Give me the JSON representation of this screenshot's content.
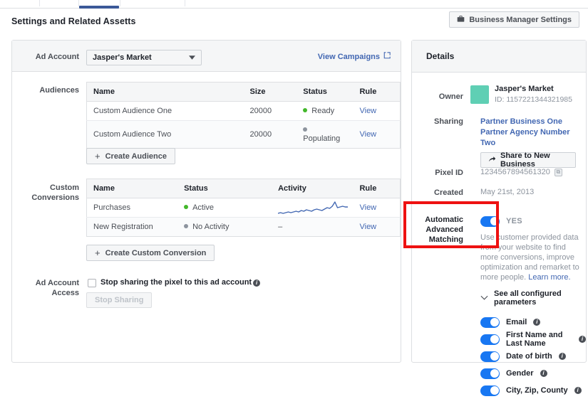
{
  "tabs": {
    "active_index": 2,
    "count": 5
  },
  "header": {
    "title": "Settings and Related Assetts",
    "bm_settings_button": "Business Manager Settings",
    "bm_settings_icon": "briefcase-icon"
  },
  "ad_account": {
    "label": "Ad Account",
    "selected": "Jasper's Market",
    "chevron_icon": "chevron-down-icon",
    "view_campaigns": "View Campaigns",
    "external_link_icon": "external-link-icon"
  },
  "audiences": {
    "label": "Audiences",
    "columns": [
      "Name",
      "Size",
      "Status",
      "Rule"
    ],
    "rows": [
      {
        "name": "Custom Audience One",
        "size": "20000",
        "status": "Ready",
        "status_dot": "green",
        "rule": "View"
      },
      {
        "name": "Custom Audience Two",
        "size": "20000",
        "status": "Populating",
        "status_dot": "gray",
        "rule": "View"
      }
    ],
    "create_button": "Create Audience"
  },
  "custom_conversions": {
    "label_line1": "Custom",
    "label_line2": "Conversions",
    "columns": [
      "Name",
      "Status",
      "Activity",
      "Rule"
    ],
    "rows": [
      {
        "name": "Purchases",
        "status": "Active",
        "status_dot": "green",
        "activity": "sparkline",
        "rule": "View"
      },
      {
        "name": "New Registration",
        "status": "No Activity",
        "status_dot": "gray",
        "activity": "–",
        "rule": "View"
      }
    ],
    "create_button": "Create Custom Conversion",
    "sparkline_color": "#4267b2",
    "sparkline_values": [
      14,
      15,
      14,
      15,
      16,
      15,
      16,
      17,
      16,
      18,
      17,
      19,
      18,
      17,
      19,
      20,
      19,
      18,
      20,
      22,
      21,
      24,
      30,
      22,
      23,
      24,
      23,
      23
    ]
  },
  "ad_account_access": {
    "label_line1": "Ad Account",
    "label_line2": "Access",
    "checkbox_label": "Stop sharing the pixel to this ad account",
    "info_icon": "info-icon",
    "button": "Stop Sharing",
    "button_disabled": true
  },
  "details": {
    "title": "Details",
    "owner_key": "Owner",
    "owner_name": "Jasper's Market",
    "owner_id": "ID: 1157221344321985",
    "owner_avatar_color": "#5fcfb4",
    "sharing_key": "Sharing",
    "partners": [
      "Partner Business One",
      "Partner Agency Number Two"
    ],
    "share_button": "Share to New Business",
    "share_icon": "share-arrow-icon",
    "pixel_key": "Pixel ID",
    "pixel_value": "1234567894561320",
    "copy_icon": "copy-icon",
    "created_key": "Created",
    "created_value": "May 21st, 2013"
  },
  "advanced_matching": {
    "label_line1": "Automatic",
    "label_line2": "Advanced",
    "label_line3": "Matching",
    "toggle_on": true,
    "toggle_label": "YES",
    "description": "Use customer provided data from your website to find more conversions, improve optimization and remarket to more people. ",
    "learn_more": "Learn more.",
    "see_params": "See all configured parameters",
    "chevron_icon": "chevron-down-icon",
    "parameters": [
      {
        "label": "Email",
        "on": true
      },
      {
        "label": "First Name and Last Name",
        "on": true
      },
      {
        "label": "Date of birth",
        "on": true
      },
      {
        "label": "Gender",
        "on": true
      },
      {
        "label": "City, Zip, County",
        "on": true
      }
    ],
    "highlight_color": "#ee1111"
  },
  "colors": {
    "accent_blue": "#1877f2",
    "link_blue": "#4267b2",
    "status_green": "#42b72a",
    "status_gray": "#8d949e"
  }
}
